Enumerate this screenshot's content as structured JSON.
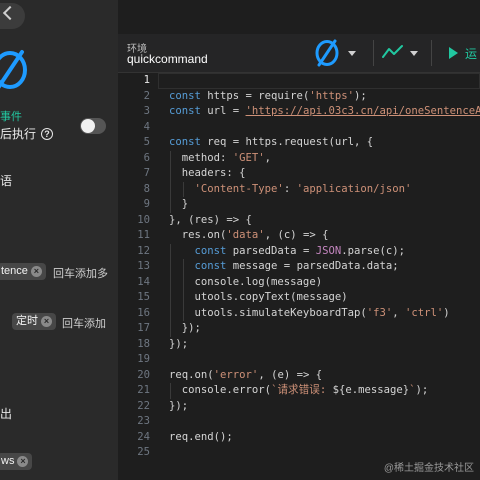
{
  "sidebar": {
    "link_text": "事件",
    "exec_label": "后执行",
    "hint": "语",
    "output_label": "出",
    "tag1": "tence",
    "enter_text1": "回车添加多",
    "tag2": "定时",
    "enter_text2": "回车添加",
    "tag3": "ws"
  },
  "topbar": {
    "env_label": "环境",
    "env_name": "quickcommand",
    "run_label": "运"
  },
  "editor": {
    "active_line": 1,
    "lines": [
      [],
      [
        [
          "kw",
          "const"
        ],
        [
          "plain",
          " https = require("
        ],
        [
          "str",
          "'https'"
        ],
        [
          "plain",
          ");"
        ]
      ],
      [
        [
          "kw",
          "const"
        ],
        [
          "plain",
          " url = "
        ],
        [
          "url",
          "'https://api.03c3.cn/api/oneSentenceAD'"
        ]
      ],
      [],
      [
        [
          "kw",
          "const"
        ],
        [
          "plain",
          " req = https.request(url, {"
        ]
      ],
      [
        [
          "plain",
          "  method: "
        ],
        [
          "str",
          "'GET'"
        ],
        [
          "plain",
          ","
        ]
      ],
      [
        [
          "plain",
          "  headers: {"
        ]
      ],
      [
        [
          "plain",
          "    "
        ],
        [
          "str",
          "'Content-Type'"
        ],
        [
          "plain",
          ": "
        ],
        [
          "str",
          "'application/json'"
        ]
      ],
      [
        [
          "plain",
          "  }"
        ]
      ],
      [
        [
          "plain",
          "}, (res) => {"
        ]
      ],
      [
        [
          "plain",
          "  res.on("
        ],
        [
          "str",
          "'data'"
        ],
        [
          "plain",
          ", (c) => {"
        ]
      ],
      [
        [
          "plain",
          "    "
        ],
        [
          "kw",
          "const"
        ],
        [
          "plain",
          " parsedData = "
        ],
        [
          "json",
          "JSON"
        ],
        [
          "plain",
          ".parse(c);"
        ]
      ],
      [
        [
          "plain",
          "    "
        ],
        [
          "kw",
          "const"
        ],
        [
          "plain",
          " message = parsedData.data;"
        ]
      ],
      [
        [
          "plain",
          "    console.log(message)"
        ]
      ],
      [
        [
          "plain",
          "    utools.copyText(message)"
        ]
      ],
      [
        [
          "plain",
          "    utools.simulateKeyboardTap("
        ],
        [
          "str",
          "'f3'"
        ],
        [
          "plain",
          ", "
        ],
        [
          "str",
          "'ctrl'"
        ],
        [
          "plain",
          ")"
        ]
      ],
      [
        [
          "plain",
          "  });"
        ]
      ],
      [
        [
          "plain",
          "});"
        ]
      ],
      [],
      [
        [
          "plain",
          "req.on("
        ],
        [
          "str",
          "'error'"
        ],
        [
          "plain",
          ", (e) => {"
        ]
      ],
      [
        [
          "plain",
          "  console.error("
        ],
        [
          "str",
          "`请求错误: "
        ],
        [
          "plain",
          "${e.message}"
        ],
        [
          "str",
          "`"
        ],
        [
          "plain",
          ");"
        ]
      ],
      [
        [
          "plain",
          "});"
        ]
      ],
      [],
      [
        [
          "plain",
          "req.end();"
        ]
      ],
      []
    ]
  },
  "watermark": "@稀土掘金技术社区",
  "colors": {
    "accent": "#21c7a0",
    "keyword": "#569cd6",
    "string": "#ce9178",
    "json": "#c586c0",
    "logo_blue": "#1e9bff"
  }
}
